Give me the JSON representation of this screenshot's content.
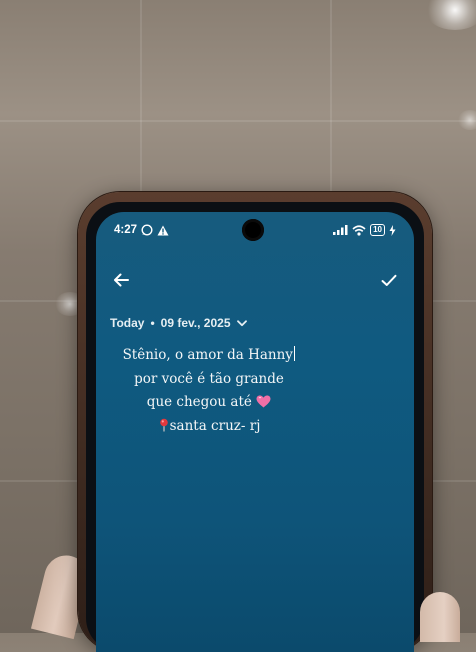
{
  "status": {
    "time": "4:27",
    "left_icons": [
      "whatsapp-icon",
      "warning-icon"
    ],
    "right_icons": [
      "signal-icon",
      "wifi-icon",
      "battery-icon",
      "charging-icon"
    ],
    "battery_level": "10"
  },
  "toolbar": {
    "back_icon": "arrow-left-icon",
    "confirm_icon": "check-icon"
  },
  "date": {
    "today_label": "Today",
    "separator": "•",
    "date_value": "09 fev., 2025",
    "dropdown_icon": "chevron-down-icon"
  },
  "note": {
    "line1": "Stênio, o amor da Hanny",
    "line2": "por você é tão grande",
    "line3": "que chegou até",
    "line3_emoji_icon": "pink-heart-icon",
    "line4_icon": "pin-icon",
    "line4": "santa cruz- rj"
  },
  "colors": {
    "screen_bg": "#0f5a80",
    "text": "#f4f6f7",
    "case": "#4a3326"
  }
}
